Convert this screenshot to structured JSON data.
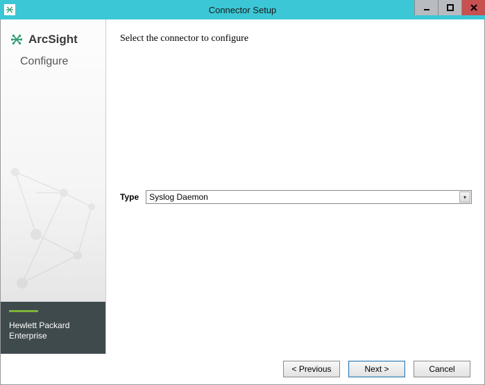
{
  "window": {
    "title": "Connector Setup"
  },
  "sidebar": {
    "brand": "ArcSight",
    "subtitle": "Configure",
    "footer_line1": "Hewlett Packard",
    "footer_line2": "Enterprise"
  },
  "main": {
    "heading": "Select the connector to configure",
    "type_label": "Type",
    "type_value": "Syslog Daemon"
  },
  "buttons": {
    "previous": "< Previous",
    "next": "Next >",
    "cancel": "Cancel"
  }
}
